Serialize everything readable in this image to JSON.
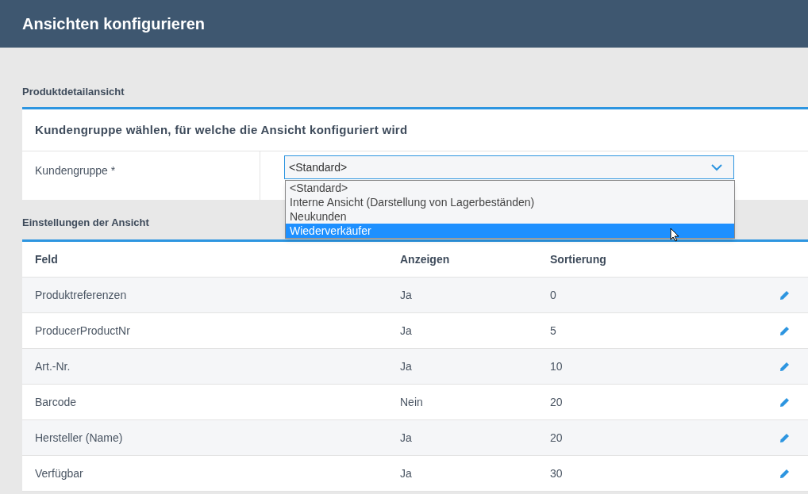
{
  "header": {
    "title": "Ansichten konfigurieren"
  },
  "section_1": {
    "label": "Produktdetailansicht",
    "card_title": "Kundengruppe wählen, für welche die Ansicht konfiguriert wird",
    "field_label": "Kundengruppe *",
    "select": {
      "value": "<Standard>",
      "expanded": true,
      "options": [
        {
          "label": "<Standard>",
          "highlighted": false
        },
        {
          "label": "Interne Ansicht (Darstellung von Lagerbeständen)",
          "highlighted": false
        },
        {
          "label": "Neukunden",
          "highlighted": false
        },
        {
          "label": "Wiederverkäufer",
          "highlighted": true
        }
      ]
    }
  },
  "section_2": {
    "label": "Einstellungen der Ansicht",
    "table": {
      "columns": [
        "Feld",
        "Anzeigen",
        "Sortierung"
      ],
      "rows": [
        {
          "feld": "Produktreferenzen",
          "anzeigen": "Ja",
          "sortierung": "0"
        },
        {
          "feld": "ProducerProductNr",
          "anzeigen": "Ja",
          "sortierung": "5"
        },
        {
          "feld": "Art.-Nr.",
          "anzeigen": "Ja",
          "sortierung": "10"
        },
        {
          "feld": "Barcode",
          "anzeigen": "Nein",
          "sortierung": "20"
        },
        {
          "feld": "Hersteller (Name)",
          "anzeigen": "Ja",
          "sortierung": "20"
        },
        {
          "feld": "Verfügbar",
          "anzeigen": "Ja",
          "sortierung": "30"
        }
      ]
    }
  }
}
